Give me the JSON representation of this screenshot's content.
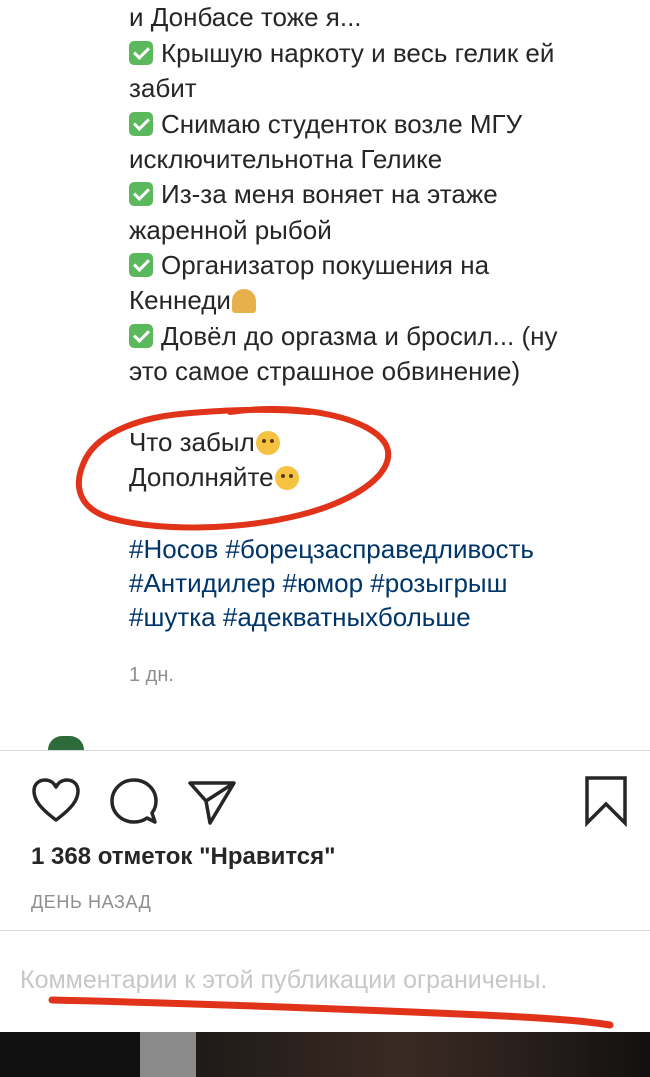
{
  "post": {
    "caption_lines": [
      "и Донбасе тоже я...",
      "Крышую наркоту и весь гелик ей",
      "забит",
      "Снимаю студенток возле МГУ",
      "исключительнотна Гелике",
      "Из-за меня воняет на этаже",
      "жаренной рыбой",
      "Организатор покушения на",
      "Кеннеди",
      "Довёл до оргазма и бросил... (ну",
      "это самое страшное обвинение)"
    ],
    "closing_lines": [
      "Что забыл",
      "Дополняйте"
    ],
    "hashtag_lines": [
      "#Носов #борецзасправедливость",
      "#Антидилер #юмор #розыгрыш",
      "#шутка #адекватныхбольше"
    ],
    "comment_time": "1 дн."
  },
  "actions": {
    "like_icon": "heart-outline-icon",
    "comment_icon": "comment-bubble-icon",
    "share_icon": "paper-plane-icon",
    "save_icon": "bookmark-outline-icon"
  },
  "likes_text": "1 368 отметок \"Нравится\"",
  "post_date": "ДЕНЬ НАЗАД",
  "comments_notice": "Комментарии к этой публикации ограничены.",
  "colors": {
    "hashtag": "#003569",
    "annotation": "#e0331a",
    "check_emoji": "#5cb85c"
  }
}
